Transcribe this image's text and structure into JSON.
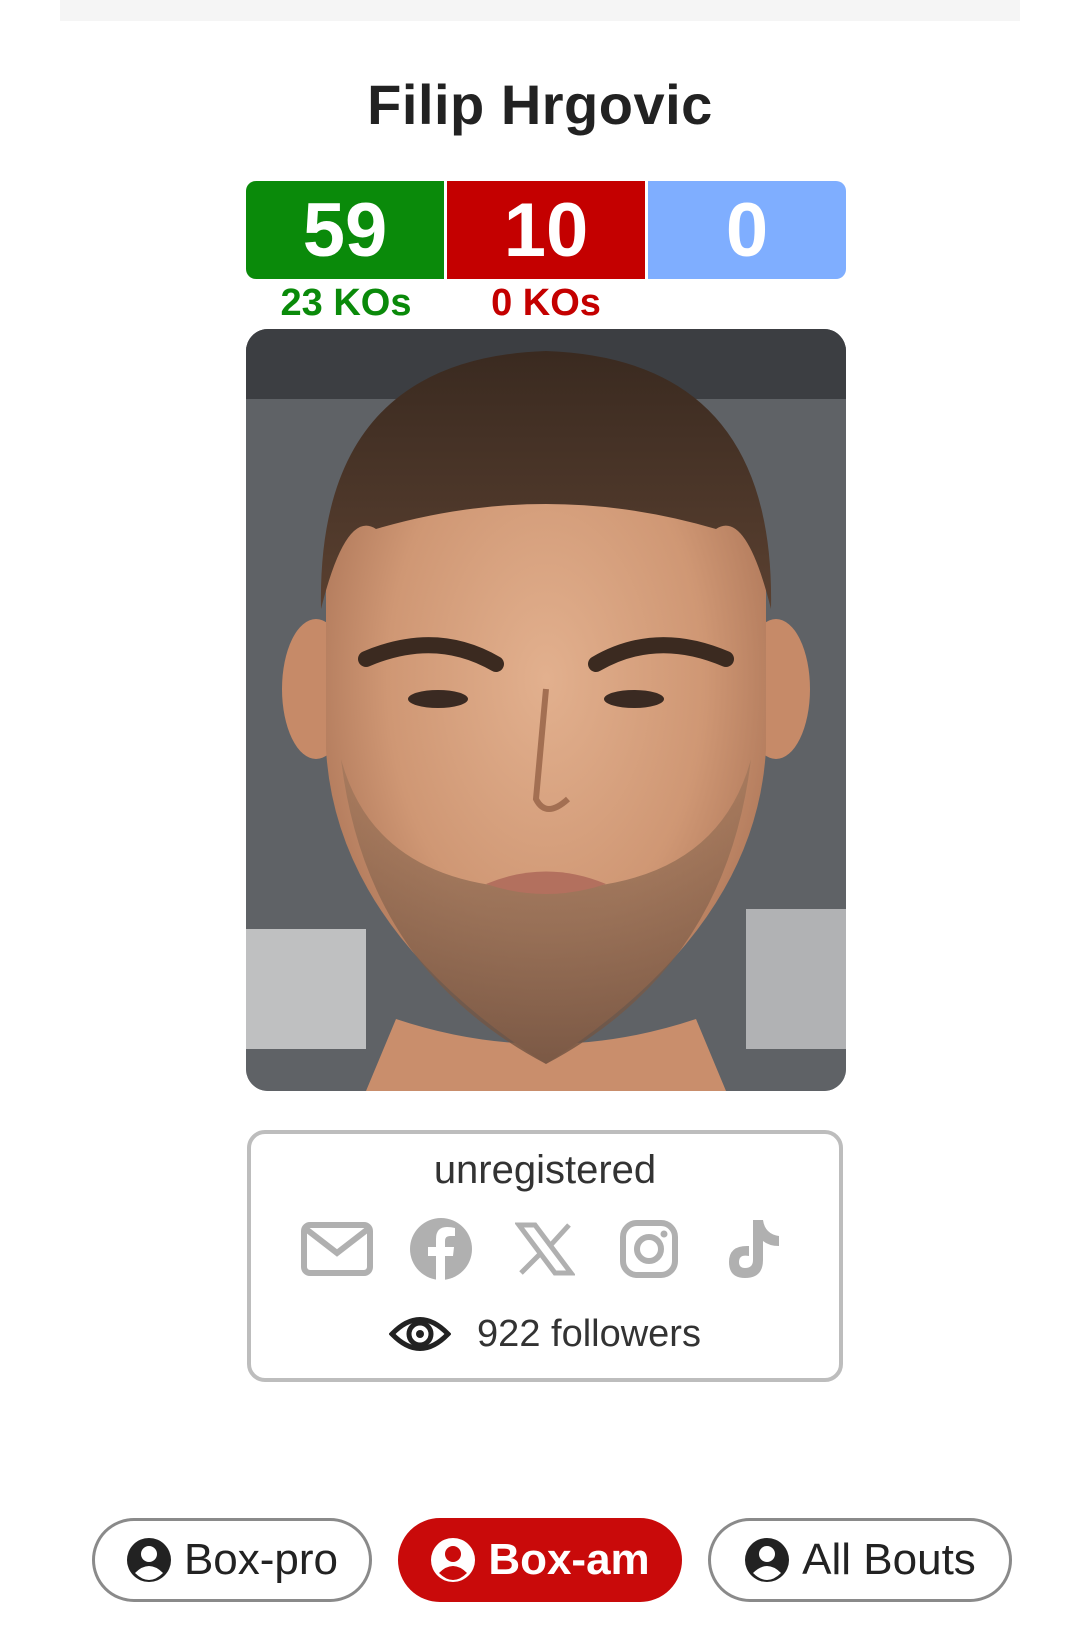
{
  "fighter": {
    "name": "Filip Hrgovic"
  },
  "record": {
    "wins": "59",
    "losses": "10",
    "draws": "0",
    "wins_kos": "23 KOs",
    "losses_kos": "0 KOs",
    "colors": {
      "win": "#0a8a0a",
      "loss": "#c40000",
      "draw": "#7faeff"
    }
  },
  "photo": {
    "icon": "fighter-portrait"
  },
  "profile": {
    "status": "unregistered",
    "socials": [
      "email-icon",
      "facebook-icon",
      "x-icon",
      "instagram-icon",
      "tiktok-icon"
    ],
    "followers": "922 followers"
  },
  "tabs": [
    {
      "label": "Box-pro",
      "icon": "user-circle-icon",
      "active": false
    },
    {
      "label": "Box-am",
      "icon": "user-circle-icon",
      "active": true
    },
    {
      "label": "All Bouts",
      "icon": "user-circle-icon",
      "active": false
    }
  ],
  "accent": "#c90a0a"
}
